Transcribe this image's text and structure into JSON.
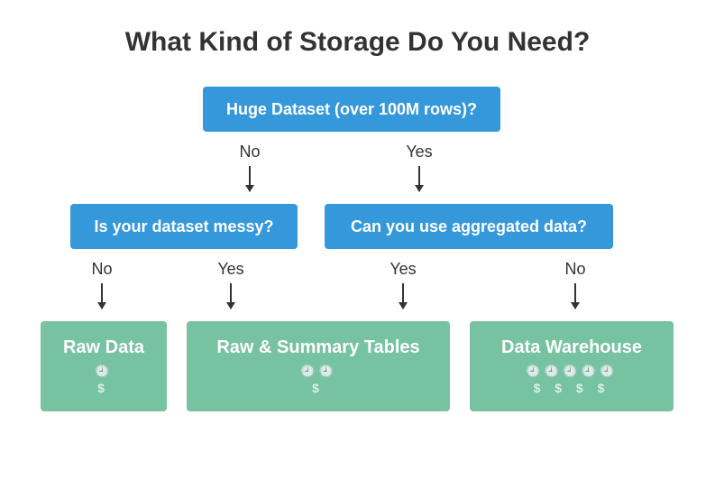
{
  "title": "What Kind of Storage Do You Need?",
  "nodes": {
    "root": "Huge Dataset (over 100M rows)?",
    "left": "Is your dataset messy?",
    "right": "Can you use aggregated data?",
    "leaf1": {
      "label": "Raw Data",
      "clocks": "🕘",
      "cost": "$"
    },
    "leaf2": {
      "label": "Raw & Summary Tables",
      "clocks": "🕘🕘",
      "cost": "$"
    },
    "leaf3": {
      "label": "Data Warehouse",
      "clocks": "🕘🕘🕘🕘🕘",
      "cost": "$  $  $  $"
    }
  },
  "edges": {
    "root_no": "No",
    "root_yes": "Yes",
    "left_no": "No",
    "left_yes": "Yes",
    "right_yes": "Yes",
    "right_no": "No"
  }
}
